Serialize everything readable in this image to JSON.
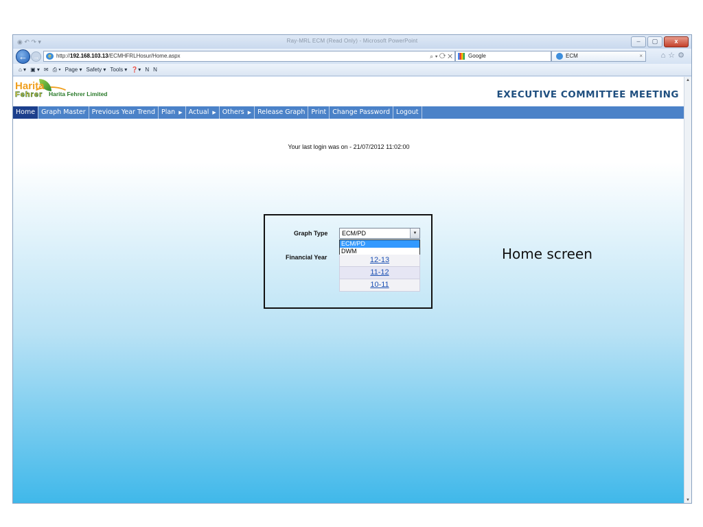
{
  "browser": {
    "window_title": "Ray-MRL ECM (Read Only) - Microsoft PowerPoint",
    "url_prefix": "http://",
    "url_host": "192.168.103.13",
    "url_path": "/ECMHFRLHosur/Home.aspx",
    "url_tools": "⌕ ▾ ⟳ ✕",
    "tab_google": "Google",
    "tab_active": "ECM",
    "tab_close": "×",
    "command_bar": [
      "⌂ ▾",
      "▣ ▾",
      "✉",
      "⎙ ▾",
      "Page ▾",
      "Safety ▾",
      "Tools ▾",
      "❓▾",
      "N",
      "N"
    ]
  },
  "site": {
    "logo_top": "Harita",
    "logo_bottom": "Fehrer",
    "company": "Harita Fehrer Limited",
    "heading": "EXECUTIVE COMMITTEE MEETING"
  },
  "menu": [
    {
      "label": "Home",
      "active": true,
      "submenu": false
    },
    {
      "label": "Graph Master",
      "active": false,
      "submenu": false
    },
    {
      "label": "Previous Year Trend",
      "active": false,
      "submenu": false
    },
    {
      "label": "Plan",
      "active": false,
      "submenu": true
    },
    {
      "label": "Actual",
      "active": false,
      "submenu": true
    },
    {
      "label": "Others",
      "active": false,
      "submenu": true
    },
    {
      "label": "Release Graph",
      "active": false,
      "submenu": false
    },
    {
      "label": "Print",
      "active": false,
      "submenu": false
    },
    {
      "label": "Change Password",
      "active": false,
      "submenu": false
    },
    {
      "label": "Logout",
      "active": false,
      "submenu": false
    }
  ],
  "login": {
    "text": "Your last login was on - 21/07/2012 11:02:00"
  },
  "form": {
    "graph_type_label": "Graph Type",
    "graph_type_value": "ECM/PD",
    "graph_type_options": [
      "ECM/PD",
      "DWM"
    ],
    "financial_year_label": "Financial Year",
    "years": [
      "12-13",
      "11-12",
      "10-11"
    ]
  },
  "slide_caption": "Home screen"
}
